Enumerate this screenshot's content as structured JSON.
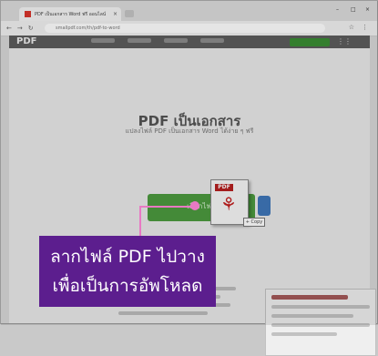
{
  "browser": {
    "tab_title": "PDF เป็นเอกสาร Word ฟรี ออนไลน์",
    "tab_close": "×",
    "address": "smallpdf.com/th/pdf-to-word",
    "back": "←",
    "forward": "→",
    "reload": "↻",
    "minimize": "–",
    "maximize": "□",
    "close": "×",
    "star": "☆",
    "menu": "⋮"
  },
  "site": {
    "logo": "PDF",
    "grid_icon": "⋮⋮"
  },
  "hero": {
    "title": "PDF เป็นเอกสาร",
    "subtitle": "แปลงไฟล์ PDF เป็นเอกสาร Word ได้ง่าย ๆ ฟรี"
  },
  "dropzone": {
    "label": "เลือกไฟล์"
  },
  "dragged_file": {
    "badge": "PDF",
    "tag": "+ Copy"
  },
  "callout": {
    "line1": "ลากไฟล์ PDF ไปวาง",
    "line2": "เพื่อเป็นการอัพโหลด",
    "color": "#5c1e8e",
    "pointer_color": "#e879c3"
  },
  "colors": {
    "nav": "#5d5d5d",
    "accent_green": "#4c9a3f",
    "pdf_red": "#c21f1f"
  }
}
